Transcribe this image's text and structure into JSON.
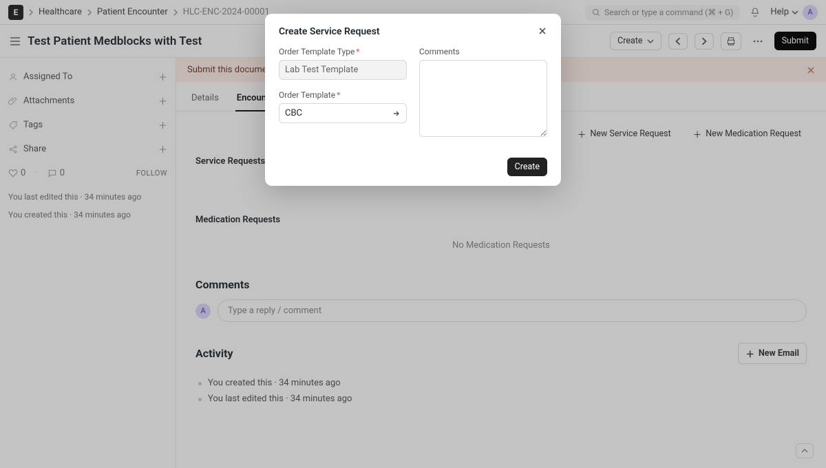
{
  "logo": "E",
  "breadcrumbs": {
    "a": "Healthcare",
    "b": "Patient Encounter",
    "c": "HLC-ENC-2024-00001"
  },
  "search_placeholder": "Search or type a command (⌘ + G)",
  "help_label": "Help",
  "avatar_initial": "A",
  "page_title": "Test Patient Medblocks with Test",
  "actions": {
    "create": "Create",
    "submit": "Submit"
  },
  "sidebar": {
    "assigned_to": "Assigned To",
    "attachments": "Attachments",
    "tags": "Tags",
    "share": "Share",
    "like_count": "0",
    "comment_count": "0",
    "follow": "FOLLOW",
    "hist_edited": "You last edited this · 34 minutes ago",
    "hist_created": "You created this · 34 minutes ago"
  },
  "banner": {
    "text": "Submit this document to confirm"
  },
  "tabs": {
    "details": "Details",
    "encounter": "Encounter"
  },
  "row_actions": {
    "new_service": "New Service Request",
    "new_medication": "New Medication Request"
  },
  "sections": {
    "service_requests": "Service Requests",
    "medication_requests": "Medication Requests",
    "no_med": "No Medication Requests"
  },
  "comments": {
    "heading": "Comments",
    "placeholder": "Type a reply / comment"
  },
  "activity": {
    "heading": "Activity",
    "new_email": "New Email",
    "items": [
      "You created this · 34 minutes ago",
      "You last edited this · 34 minutes ago"
    ]
  },
  "modal": {
    "title": "Create Service Request",
    "create": "Create",
    "fields": {
      "type_label": "Order Template Type",
      "type_value": "Lab Test Template",
      "template_label": "Order Template",
      "template_value": "CBC",
      "comments_label": "Comments"
    }
  }
}
